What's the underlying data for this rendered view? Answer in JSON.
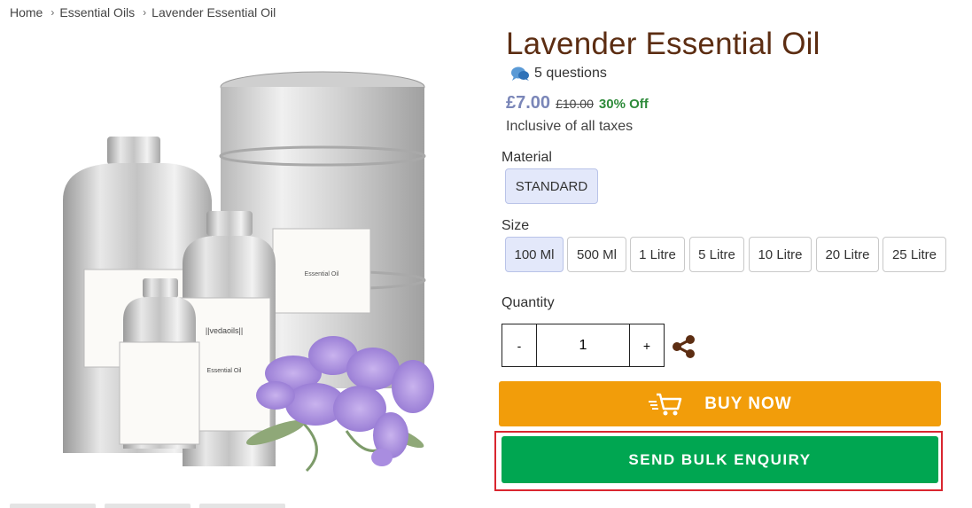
{
  "breadcrumb": {
    "items": [
      "Home",
      "Essential Oils",
      "Lavender Essential Oil"
    ]
  },
  "product": {
    "title": "Lavender Essential Oil",
    "questions": "5 questions",
    "price": "£7.00",
    "old_price": "£10.00",
    "discount": "30% Off",
    "tax_note": "Inclusive of all taxes"
  },
  "gallery": {
    "label_brand": "||vedaoils||",
    "label_text": "Essential Oil"
  },
  "material": {
    "label": "Material",
    "options": [
      "STANDARD"
    ],
    "selected": "STANDARD"
  },
  "size": {
    "label": "Size",
    "options": [
      "100 Ml",
      "500 Ml",
      "1 Litre",
      "5 Litre",
      "10 Litre",
      "20 Litre",
      "25 Litre"
    ],
    "selected": "100 Ml"
  },
  "quantity": {
    "label": "Quantity",
    "value": "1",
    "minus": "-",
    "plus": "+"
  },
  "actions": {
    "buy_now": "BUY NOW",
    "bulk_enquiry": "SEND BULK ENQUIRY"
  },
  "colors": {
    "title": "#5c2d12",
    "price": "#7a86b8",
    "discount": "#2e8b3a",
    "buy_now": "#f29d0a",
    "bulk_enquiry": "#00a651",
    "highlight_outline": "#d9262f"
  }
}
